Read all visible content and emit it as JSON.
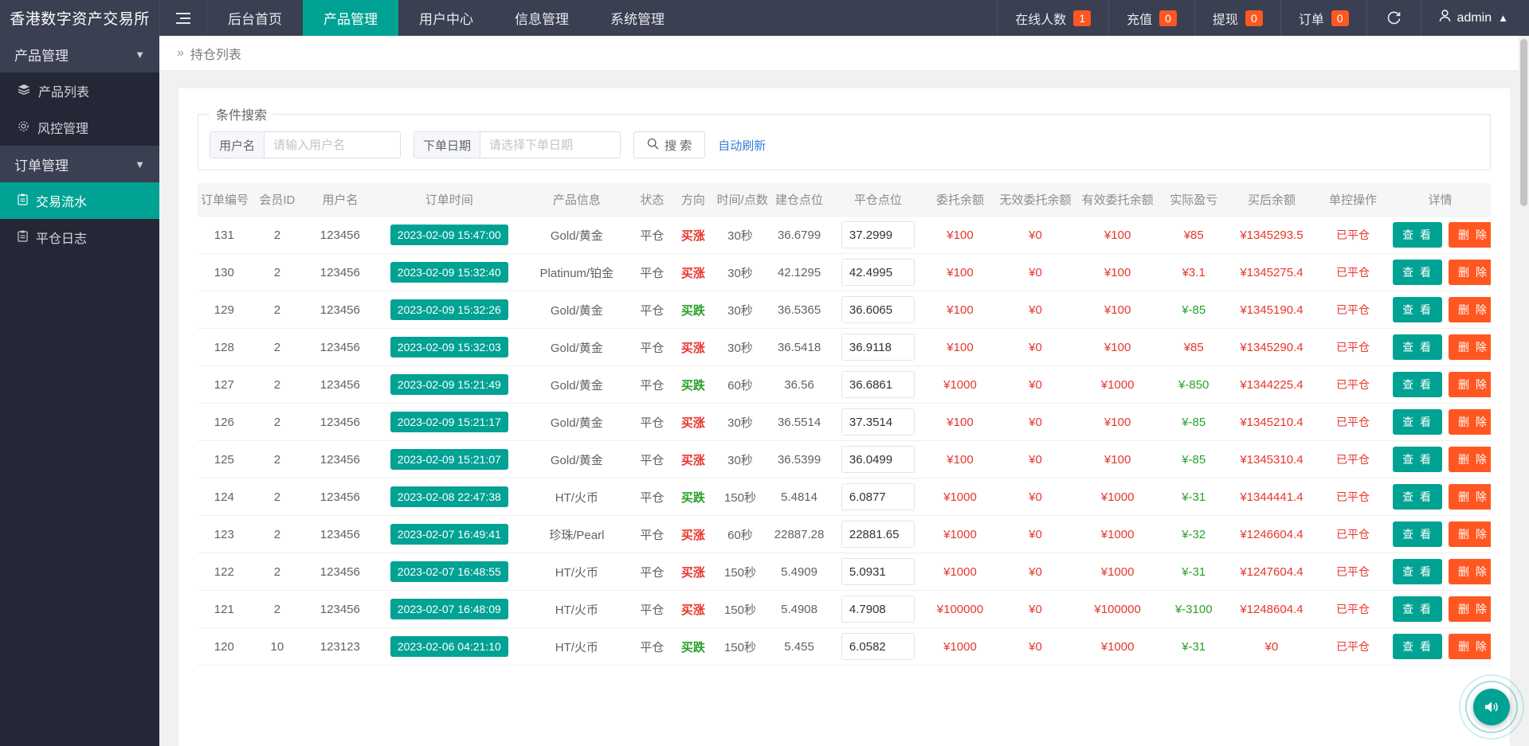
{
  "topbar": {
    "brand": "香港数字资产交易所",
    "hamburger_icon": "hamburger-icon",
    "nav": [
      {
        "label": "后台首页",
        "active": false
      },
      {
        "label": "产品管理",
        "active": true
      },
      {
        "label": "用户中心",
        "active": false
      },
      {
        "label": "信息管理",
        "active": false
      },
      {
        "label": "系统管理",
        "active": false
      }
    ],
    "stats": [
      {
        "label": "在线人数",
        "count": "1"
      },
      {
        "label": "充值",
        "count": "0"
      },
      {
        "label": "提现",
        "count": "0"
      },
      {
        "label": "订单",
        "count": "0"
      }
    ],
    "refresh_icon": "refresh-icon",
    "user_icon": "user-icon",
    "user_name": "admin",
    "user_chevron": "chevron-up-icon"
  },
  "sidebar": {
    "groups": [
      {
        "label": "产品管理",
        "chevron": "chevron-down-icon",
        "items": [
          {
            "label": "产品列表",
            "icon": "layers-icon",
            "active": false
          },
          {
            "label": "风控管理",
            "icon": "gear-icon",
            "active": false
          }
        ]
      },
      {
        "label": "订单管理",
        "chevron": "chevron-down-icon",
        "items": [
          {
            "label": "交易流水",
            "icon": "clipboard-icon",
            "active": true
          },
          {
            "label": "平仓日志",
            "icon": "clipboard-icon",
            "active": false
          }
        ]
      }
    ]
  },
  "breadcrumb": {
    "arrows": "»",
    "current": "持仓列表"
  },
  "search": {
    "legend": "条件搜索",
    "username_label": "用户名",
    "username_value": "",
    "username_placeholder": "请输入用户名",
    "date_label": "下单日期",
    "date_value": "",
    "date_placeholder": "请选择下单日期",
    "search_button": "搜 索",
    "search_icon": "search-icon",
    "auto_refresh_link": "自动刷新"
  },
  "table": {
    "columns": [
      "订单编号",
      "会员ID",
      "用户名",
      "订单时间",
      "产品信息",
      "状态",
      "方向",
      "时间/点数",
      "建仓点位",
      "平仓点位",
      "委托余额",
      "无效委托余额",
      "有效委托余额",
      "实际盈亏",
      "买后余额",
      "单控操作",
      "详情"
    ],
    "view_button": "查 看",
    "delete_button": "删 除",
    "rows": [
      {
        "id": "131",
        "member": "2",
        "user": "123456",
        "time": "2023-02-09 15:47:00",
        "product": "Gold/黄金",
        "status": "平仓",
        "dir": "买涨",
        "dir_up": true,
        "dur": "30秒",
        "open": "36.6799",
        "close": "37.2999",
        "entrust": "¥100",
        "invalid": "¥0",
        "valid": "¥100",
        "pnl": "¥85",
        "pnl_pos": true,
        "balance": "¥1345293.5",
        "ctrl": "已平仓"
      },
      {
        "id": "130",
        "member": "2",
        "user": "123456",
        "time": "2023-02-09 15:32:40",
        "product": "Platinum/铂金",
        "status": "平仓",
        "dir": "买涨",
        "dir_up": true,
        "dur": "30秒",
        "open": "42.1295",
        "close": "42.4995",
        "entrust": "¥100",
        "invalid": "¥0",
        "valid": "¥100",
        "pnl": "¥3.1",
        "pnl_pos": true,
        "balance": "¥1345275.4",
        "ctrl": "已平仓"
      },
      {
        "id": "129",
        "member": "2",
        "user": "123456",
        "time": "2023-02-09 15:32:26",
        "product": "Gold/黄金",
        "status": "平仓",
        "dir": "买跌",
        "dir_up": false,
        "dur": "30秒",
        "open": "36.5365",
        "close": "36.6065",
        "entrust": "¥100",
        "invalid": "¥0",
        "valid": "¥100",
        "pnl": "¥-85",
        "pnl_pos": false,
        "balance": "¥1345190.4",
        "ctrl": "已平仓"
      },
      {
        "id": "128",
        "member": "2",
        "user": "123456",
        "time": "2023-02-09 15:32:03",
        "product": "Gold/黄金",
        "status": "平仓",
        "dir": "买涨",
        "dir_up": true,
        "dur": "30秒",
        "open": "36.5418",
        "close": "36.9118",
        "entrust": "¥100",
        "invalid": "¥0",
        "valid": "¥100",
        "pnl": "¥85",
        "pnl_pos": true,
        "balance": "¥1345290.4",
        "ctrl": "已平仓"
      },
      {
        "id": "127",
        "member": "2",
        "user": "123456",
        "time": "2023-02-09 15:21:49",
        "product": "Gold/黄金",
        "status": "平仓",
        "dir": "买跌",
        "dir_up": false,
        "dur": "60秒",
        "open": "36.56",
        "close": "36.6861",
        "entrust": "¥1000",
        "invalid": "¥0",
        "valid": "¥1000",
        "pnl": "¥-850",
        "pnl_pos": false,
        "balance": "¥1344225.4",
        "ctrl": "已平仓"
      },
      {
        "id": "126",
        "member": "2",
        "user": "123456",
        "time": "2023-02-09 15:21:17",
        "product": "Gold/黄金",
        "status": "平仓",
        "dir": "买涨",
        "dir_up": true,
        "dur": "30秒",
        "open": "36.5514",
        "close": "37.3514",
        "entrust": "¥100",
        "invalid": "¥0",
        "valid": "¥100",
        "pnl": "¥-85",
        "pnl_pos": false,
        "balance": "¥1345210.4",
        "ctrl": "已平仓"
      },
      {
        "id": "125",
        "member": "2",
        "user": "123456",
        "time": "2023-02-09 15:21:07",
        "product": "Gold/黄金",
        "status": "平仓",
        "dir": "买涨",
        "dir_up": true,
        "dur": "30秒",
        "open": "36.5399",
        "close": "36.0499",
        "entrust": "¥100",
        "invalid": "¥0",
        "valid": "¥100",
        "pnl": "¥-85",
        "pnl_pos": false,
        "balance": "¥1345310.4",
        "ctrl": "已平仓"
      },
      {
        "id": "124",
        "member": "2",
        "user": "123456",
        "time": "2023-02-08 22:47:38",
        "product": "HT/火币",
        "status": "平仓",
        "dir": "买跌",
        "dir_up": false,
        "dur": "150秒",
        "open": "5.4814",
        "close": "6.0877",
        "entrust": "¥1000",
        "invalid": "¥0",
        "valid": "¥1000",
        "pnl": "¥-31",
        "pnl_pos": false,
        "balance": "¥1344441.4",
        "ctrl": "已平仓"
      },
      {
        "id": "123",
        "member": "2",
        "user": "123456",
        "time": "2023-02-07 16:49:41",
        "product": "珍珠/Pearl",
        "status": "平仓",
        "dir": "买涨",
        "dir_up": true,
        "dur": "60秒",
        "open": "22887.28",
        "close": "22881.65",
        "entrust": "¥1000",
        "invalid": "¥0",
        "valid": "¥1000",
        "pnl": "¥-32",
        "pnl_pos": false,
        "balance": "¥1246604.4",
        "ctrl": "已平仓"
      },
      {
        "id": "122",
        "member": "2",
        "user": "123456",
        "time": "2023-02-07 16:48:55",
        "product": "HT/火币",
        "status": "平仓",
        "dir": "买涨",
        "dir_up": true,
        "dur": "150秒",
        "open": "5.4909",
        "close": "5.0931",
        "entrust": "¥1000",
        "invalid": "¥0",
        "valid": "¥1000",
        "pnl": "¥-31",
        "pnl_pos": false,
        "balance": "¥1247604.4",
        "ctrl": "已平仓"
      },
      {
        "id": "121",
        "member": "2",
        "user": "123456",
        "time": "2023-02-07 16:48:09",
        "product": "HT/火币",
        "status": "平仓",
        "dir": "买涨",
        "dir_up": true,
        "dur": "150秒",
        "open": "5.4908",
        "close": "4.7908",
        "entrust": "¥100000",
        "invalid": "¥0",
        "valid": "¥100000",
        "pnl": "¥-3100",
        "pnl_pos": false,
        "balance": "¥1248604.4",
        "ctrl": "已平仓"
      },
      {
        "id": "120",
        "member": "10",
        "user": "123123",
        "time": "2023-02-06 04:21:10",
        "product": "HT/火币",
        "status": "平仓",
        "dir": "买跌",
        "dir_up": false,
        "dur": "150秒",
        "open": "5.455",
        "close": "6.0582",
        "entrust": "¥1000",
        "invalid": "¥0",
        "valid": "¥1000",
        "pnl": "¥-31",
        "pnl_pos": false,
        "balance": "¥0",
        "ctrl": "已平仓"
      }
    ]
  },
  "fab": {
    "icon": "volume-icon"
  },
  "colors": {
    "accent": "#00a294",
    "danger": "#ff5722",
    "red": "#e8352b",
    "green": "#2aa02a",
    "navy": "#3a3f51",
    "sidebar": "#242836"
  }
}
